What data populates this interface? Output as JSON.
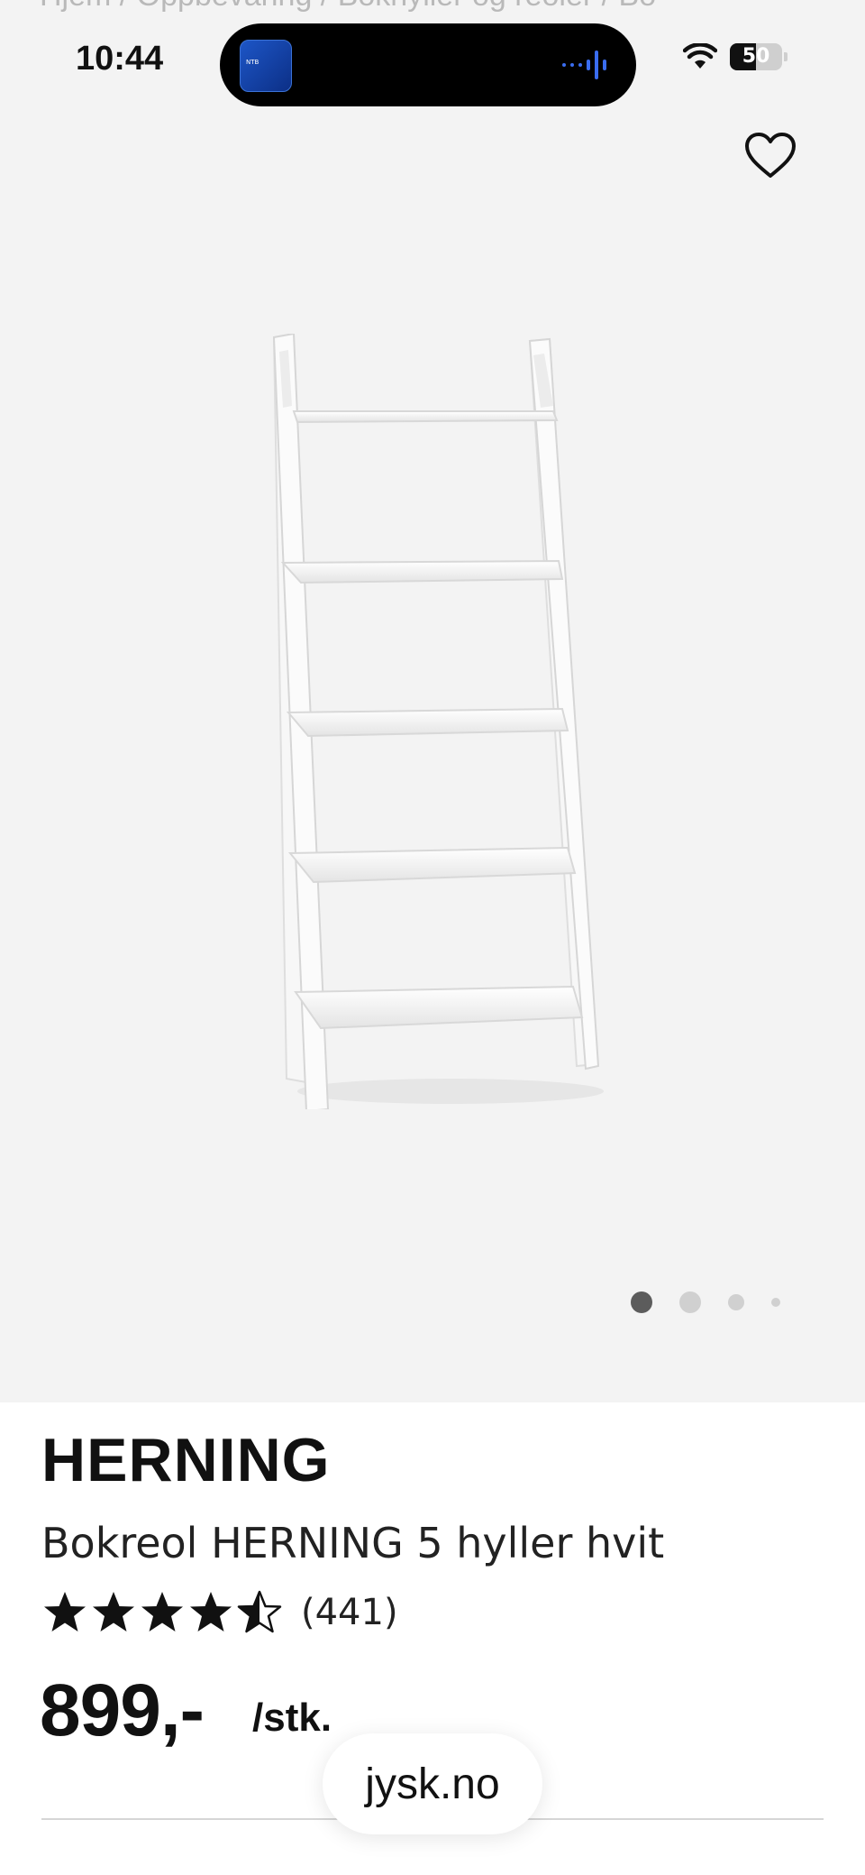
{
  "status_bar": {
    "time": "10:44",
    "battery": "50",
    "battery_level": 0.5,
    "island_app_label": "NTB"
  },
  "breadcrumb_peek": "Hjem  /  Oppbevaring  /  Bokhyller og reoler  /  Bo",
  "gallery": {
    "total_images": 4,
    "active_index": 0
  },
  "product": {
    "brand": "HERNING",
    "name": "Bokreol HERNING 5 hyller hvit",
    "rating": 4.5,
    "rating_count": "(441)",
    "price": "899,-",
    "unit": "/stk."
  },
  "browser": {
    "url": "jysk.no"
  },
  "icons": {
    "favorite": "heart-outline-icon",
    "wifi": "wifi-icon",
    "star": "star-icon"
  },
  "colors": {
    "background_gallery": "#f3f3f3",
    "text": "#111111",
    "dot_active": "#5c5c5c",
    "dot_inactive": "#d0d0d0"
  }
}
